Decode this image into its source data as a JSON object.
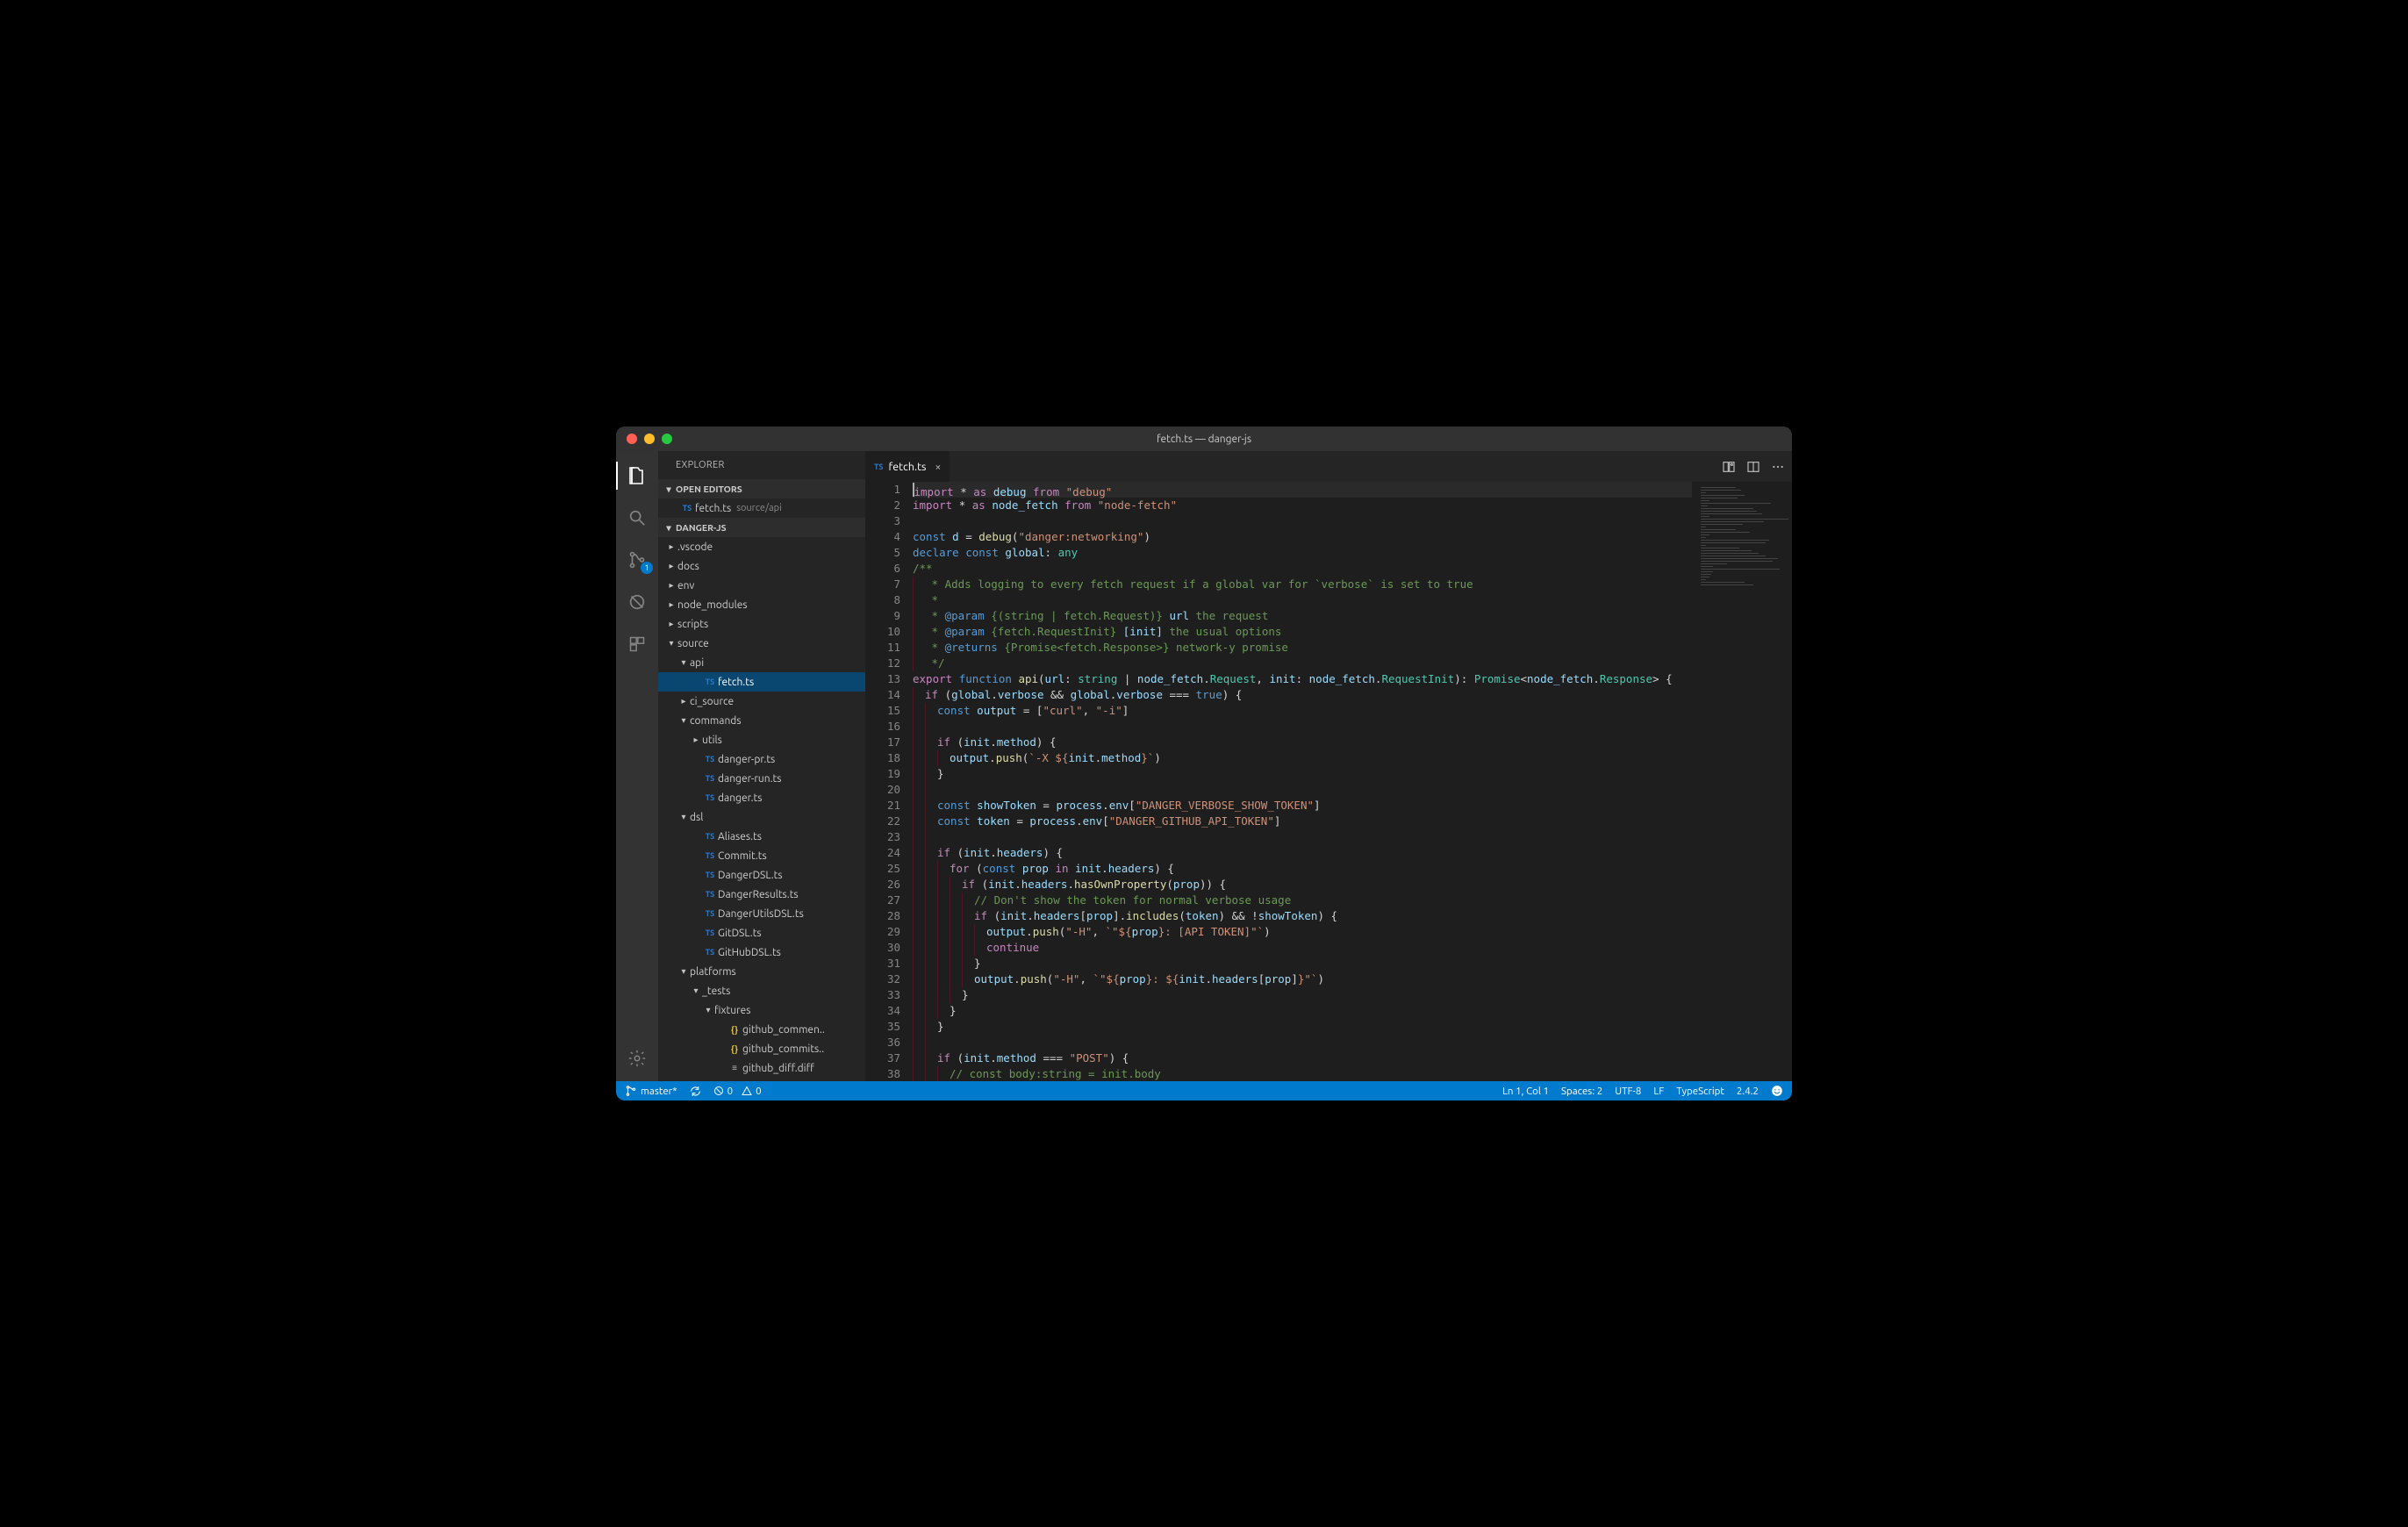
{
  "window": {
    "title": "fetch.ts — danger-js"
  },
  "activitybar": {
    "scm_badge": "1"
  },
  "sidebar": {
    "title": "EXPLORER",
    "open_editors_label": "OPEN EDITORS",
    "project_label": "DANGER-JS",
    "open_editors": [
      {
        "name": "fetch.ts",
        "hint": "source/api",
        "icon": "ts"
      }
    ],
    "tree": [
      {
        "depth": 0,
        "kind": "folder",
        "open": false,
        "name": ".vscode"
      },
      {
        "depth": 0,
        "kind": "folder",
        "open": false,
        "name": "docs"
      },
      {
        "depth": 0,
        "kind": "folder",
        "open": false,
        "name": "env"
      },
      {
        "depth": 0,
        "kind": "folder",
        "open": false,
        "name": "node_modules"
      },
      {
        "depth": 0,
        "kind": "folder",
        "open": false,
        "name": "scripts"
      },
      {
        "depth": 0,
        "kind": "folder",
        "open": true,
        "name": "source"
      },
      {
        "depth": 1,
        "kind": "folder",
        "open": true,
        "name": "api"
      },
      {
        "depth": 2,
        "kind": "file",
        "icon": "ts",
        "name": "fetch.ts",
        "active": true
      },
      {
        "depth": 1,
        "kind": "folder",
        "open": false,
        "name": "ci_source"
      },
      {
        "depth": 1,
        "kind": "folder",
        "open": true,
        "name": "commands"
      },
      {
        "depth": 2,
        "kind": "folder",
        "open": false,
        "name": "utils"
      },
      {
        "depth": 2,
        "kind": "file",
        "icon": "ts",
        "name": "danger-pr.ts"
      },
      {
        "depth": 2,
        "kind": "file",
        "icon": "ts",
        "name": "danger-run.ts"
      },
      {
        "depth": 2,
        "kind": "file",
        "icon": "ts",
        "name": "danger.ts"
      },
      {
        "depth": 1,
        "kind": "folder",
        "open": true,
        "name": "dsl"
      },
      {
        "depth": 2,
        "kind": "file",
        "icon": "ts",
        "name": "Aliases.ts"
      },
      {
        "depth": 2,
        "kind": "file",
        "icon": "ts",
        "name": "Commit.ts"
      },
      {
        "depth": 2,
        "kind": "file",
        "icon": "ts",
        "name": "DangerDSL.ts"
      },
      {
        "depth": 2,
        "kind": "file",
        "icon": "ts",
        "name": "DangerResults.ts"
      },
      {
        "depth": 2,
        "kind": "file",
        "icon": "ts",
        "name": "DangerUtilsDSL.ts"
      },
      {
        "depth": 2,
        "kind": "file",
        "icon": "ts",
        "name": "GitDSL.ts"
      },
      {
        "depth": 2,
        "kind": "file",
        "icon": "ts",
        "name": "GitHubDSL.ts"
      },
      {
        "depth": 1,
        "kind": "folder",
        "open": true,
        "name": "platforms"
      },
      {
        "depth": 2,
        "kind": "folder",
        "open": true,
        "name": "_tests"
      },
      {
        "depth": 3,
        "kind": "folder",
        "open": true,
        "name": "fixtures"
      },
      {
        "depth": 4,
        "kind": "file",
        "icon": "json",
        "name": "github_commen.."
      },
      {
        "depth": 4,
        "kind": "file",
        "icon": "json",
        "name": "github_commits.."
      },
      {
        "depth": 4,
        "kind": "file",
        "icon": "diff",
        "name": "github_diff.diff"
      }
    ]
  },
  "tab": {
    "icon": "TS",
    "filename": "fetch.ts"
  },
  "code": {
    "lines": [
      {
        "n": 1,
        "current": true,
        "html": "<span class='kw'>import</span> <span class='op'>*</span> <span class='kw'>as</span> <span class='var'>debug</span> <span class='kw'>from</span> <span class='str'>\"debug\"</span>"
      },
      {
        "n": 2,
        "html": "<span class='kw'>import</span> <span class='op'>*</span> <span class='kw'>as</span> <span class='var'>node_fetch</span> <span class='kw'>from</span> <span class='str'>\"node-fetch\"</span>"
      },
      {
        "n": 3,
        "html": ""
      },
      {
        "n": 4,
        "html": "<span class='kw2'>const</span> <span class='var'>d</span> = <span class='fn'>debug</span>(<span class='str'>\"danger:networking\"</span>)"
      },
      {
        "n": 5,
        "html": "<span class='kw2'>declare</span> <span class='kw2'>const</span> <span class='var'>global</span>: <span class='type'>any</span>"
      },
      {
        "n": 6,
        "html": "<span class='doc'>/**</span>"
      },
      {
        "n": 7,
        "ind": 1,
        "html": "<span class='doc'> * Adds logging to every fetch request if a global var for `verbose` is set to true</span>"
      },
      {
        "n": 8,
        "ind": 1,
        "html": "<span class='doc'> *</span>"
      },
      {
        "n": 9,
        "ind": 1,
        "html": "<span class='doc'> * </span><span class='doct'>@param</span><span class='doc'> {(string | fetch.Request)} </span><span class='var'>url</span><span class='doc'> the request</span>"
      },
      {
        "n": 10,
        "ind": 1,
        "html": "<span class='doc'> * </span><span class='doct'>@param</span><span class='doc'> {fetch.RequestInit} </span><span class='var'>[init]</span><span class='doc'> the usual options</span>"
      },
      {
        "n": 11,
        "ind": 1,
        "html": "<span class='doc'> * </span><span class='doct'>@returns</span><span class='doc'> {Promise&lt;fetch.Response&gt;} network-y promise</span>"
      },
      {
        "n": 12,
        "ind": 1,
        "html": "<span class='doc'> */</span>"
      },
      {
        "n": 13,
        "html": "<span class='kw'>export</span> <span class='kw2'>function</span> <span class='fn'>api</span>(<span class='var'>url</span>: <span class='type'>string</span> | <span class='var'>node_fetch</span>.<span class='type'>Request</span>, <span class='var'>init</span>: <span class='var'>node_fetch</span>.<span class='type'>RequestInit</span>): <span class='type'>Promise</span>&lt;<span class='var'>node_fetch</span>.<span class='type'>Response</span>&gt; {"
      },
      {
        "n": 14,
        "ind": 1,
        "html": "<span class='kw'>if</span> (<span class='var'>global</span>.<span class='var'>verbose</span> &amp;&amp; <span class='var'>global</span>.<span class='var'>verbose</span> === <span class='kw2'>true</span>) {"
      },
      {
        "n": 15,
        "ind": 2,
        "html": "<span class='kw2'>const</span> <span class='var'>output</span> = [<span class='str'>\"curl\"</span>, <span class='str'>\"-i\"</span>]"
      },
      {
        "n": 16,
        "ind": 2,
        "html": ""
      },
      {
        "n": 17,
        "ind": 2,
        "html": "<span class='kw'>if</span> (<span class='var'>init</span>.<span class='var'>method</span>) {"
      },
      {
        "n": 18,
        "ind": 3,
        "html": "<span class='var'>output</span>.<span class='fn'>push</span>(<span class='str'>`-X ${</span><span class='var'>init</span>.<span class='var'>method</span><span class='str'>}`</span>)"
      },
      {
        "n": 19,
        "ind": 2,
        "html": "}"
      },
      {
        "n": 20,
        "ind": 2,
        "html": ""
      },
      {
        "n": 21,
        "ind": 2,
        "html": "<span class='kw2'>const</span> <span class='var'>showToken</span> = <span class='var'>process</span>.<span class='var'>env</span>[<span class='str'>\"DANGER_VERBOSE_SHOW_TOKEN\"</span>]"
      },
      {
        "n": 22,
        "ind": 2,
        "html": "<span class='kw2'>const</span> <span class='var'>token</span> = <span class='var'>process</span>.<span class='var'>env</span>[<span class='str'>\"DANGER_GITHUB_API_TOKEN\"</span>]"
      },
      {
        "n": 23,
        "ind": 2,
        "html": ""
      },
      {
        "n": 24,
        "ind": 2,
        "html": "<span class='kw'>if</span> (<span class='var'>init</span>.<span class='var'>headers</span>) {"
      },
      {
        "n": 25,
        "ind": 3,
        "html": "<span class='kw'>for</span> (<span class='kw2'>const</span> <span class='var'>prop</span> <span class='kw'>in</span> <span class='var'>init</span>.<span class='var'>headers</span>) {"
      },
      {
        "n": 26,
        "ind": 4,
        "html": "<span class='kw'>if</span> (<span class='var'>init</span>.<span class='var'>headers</span>.<span class='fn'>hasOwnProperty</span>(<span class='var'>prop</span>)) {"
      },
      {
        "n": 27,
        "ind": 5,
        "html": "<span class='cm'>// Don't show the token for normal verbose usage</span>"
      },
      {
        "n": 28,
        "ind": 5,
        "html": "<span class='kw'>if</span> (<span class='var'>init</span>.<span class='var'>headers</span>[<span class='var'>prop</span>].<span class='fn'>includes</span>(<span class='var'>token</span>) &amp;&amp; !<span class='var'>showToken</span>) {"
      },
      {
        "n": 29,
        "ind": 6,
        "html": "<span class='var'>output</span>.<span class='fn'>push</span>(<span class='str'>\"-H\"</span>, <span class='str'>`\"${</span><span class='var'>prop</span><span class='str'>}: [API TOKEN]\"`</span>)"
      },
      {
        "n": 30,
        "ind": 6,
        "html": "<span class='kw'>continue</span>"
      },
      {
        "n": 31,
        "ind": 5,
        "html": "}"
      },
      {
        "n": 32,
        "ind": 5,
        "html": "<span class='var'>output</span>.<span class='fn'>push</span>(<span class='str'>\"-H\"</span>, <span class='str'>`\"${</span><span class='var'>prop</span><span class='str'>}: ${</span><span class='var'>init</span>.<span class='var'>headers</span>[<span class='var'>prop</span>]<span class='str'>}\"`</span>)"
      },
      {
        "n": 33,
        "ind": 4,
        "html": "}"
      },
      {
        "n": 34,
        "ind": 3,
        "html": "}"
      },
      {
        "n": 35,
        "ind": 2,
        "html": "}"
      },
      {
        "n": 36,
        "ind": 2,
        "html": ""
      },
      {
        "n": 37,
        "ind": 2,
        "html": "<span class='kw'>if</span> (<span class='var'>init</span>.<span class='var'>method</span> === <span class='str'>\"POST\"</span>) {"
      },
      {
        "n": 38,
        "ind": 3,
        "html": "<span class='cm'>// const body:string = init.body</span>"
      }
    ]
  },
  "statusbar": {
    "branch": "master*",
    "errors": "0",
    "warnings": "0",
    "cursor": "Ln 1, Col 1",
    "spaces": "Spaces: 2",
    "encoding": "UTF-8",
    "eol": "LF",
    "language": "TypeScript",
    "version": "2.4.2"
  }
}
